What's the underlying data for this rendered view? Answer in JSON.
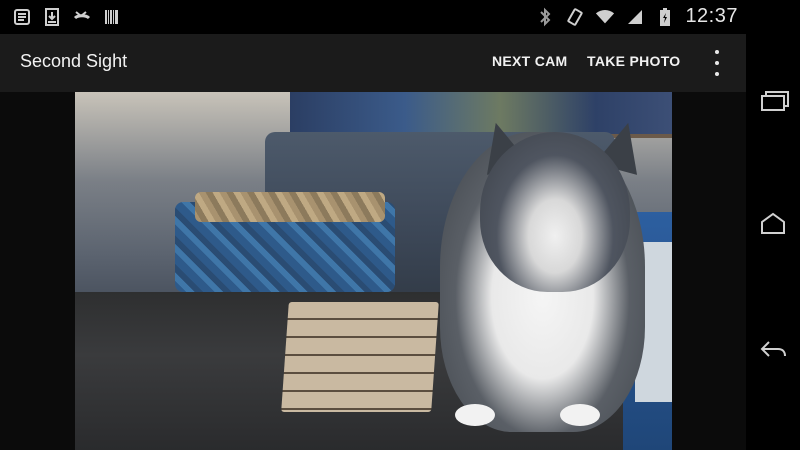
{
  "status_bar": {
    "time": "12:37",
    "left_icons": [
      "notification-list-icon",
      "download-icon",
      "missed-call-icon",
      "barcode-icon"
    ],
    "right_icons": [
      "bluetooth-icon",
      "rotation-icon",
      "wifi-icon",
      "signal-icon",
      "battery-charging-icon"
    ]
  },
  "action_bar": {
    "title": "Second Sight",
    "next_cam_label": "NEXT CAM",
    "take_photo_label": "TAKE PHOTO",
    "overflow_icon": "overflow-menu-icon"
  },
  "camera_preview": {
    "subject": "camera-preview"
  },
  "nav_bar": {
    "recents_icon": "recents-icon",
    "home_icon": "home-icon",
    "back_icon": "back-icon"
  }
}
